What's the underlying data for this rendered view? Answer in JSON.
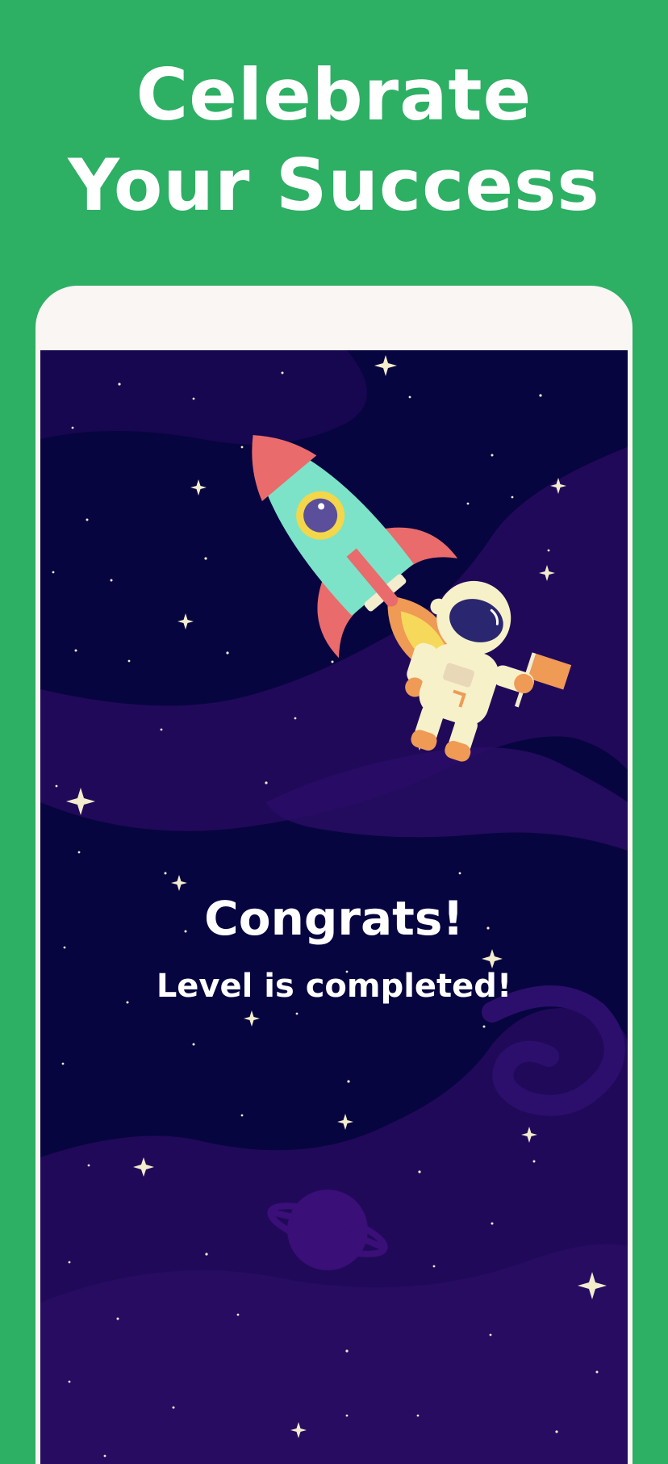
{
  "promo": {
    "headline_line1": "Celebrate",
    "headline_line2": "Your Success"
  },
  "screen": {
    "title": "Congrats!",
    "subtitle": "Level is completed!"
  },
  "colors": {
    "background": "#2daf64",
    "phone_frame": "#faf6f3",
    "space": "#07053f",
    "nebula": "#21095a",
    "text": "#ffffff"
  },
  "icons": [
    "rocket-icon",
    "astronaut-icon",
    "flag-icon",
    "planet-icon",
    "star-icon"
  ]
}
